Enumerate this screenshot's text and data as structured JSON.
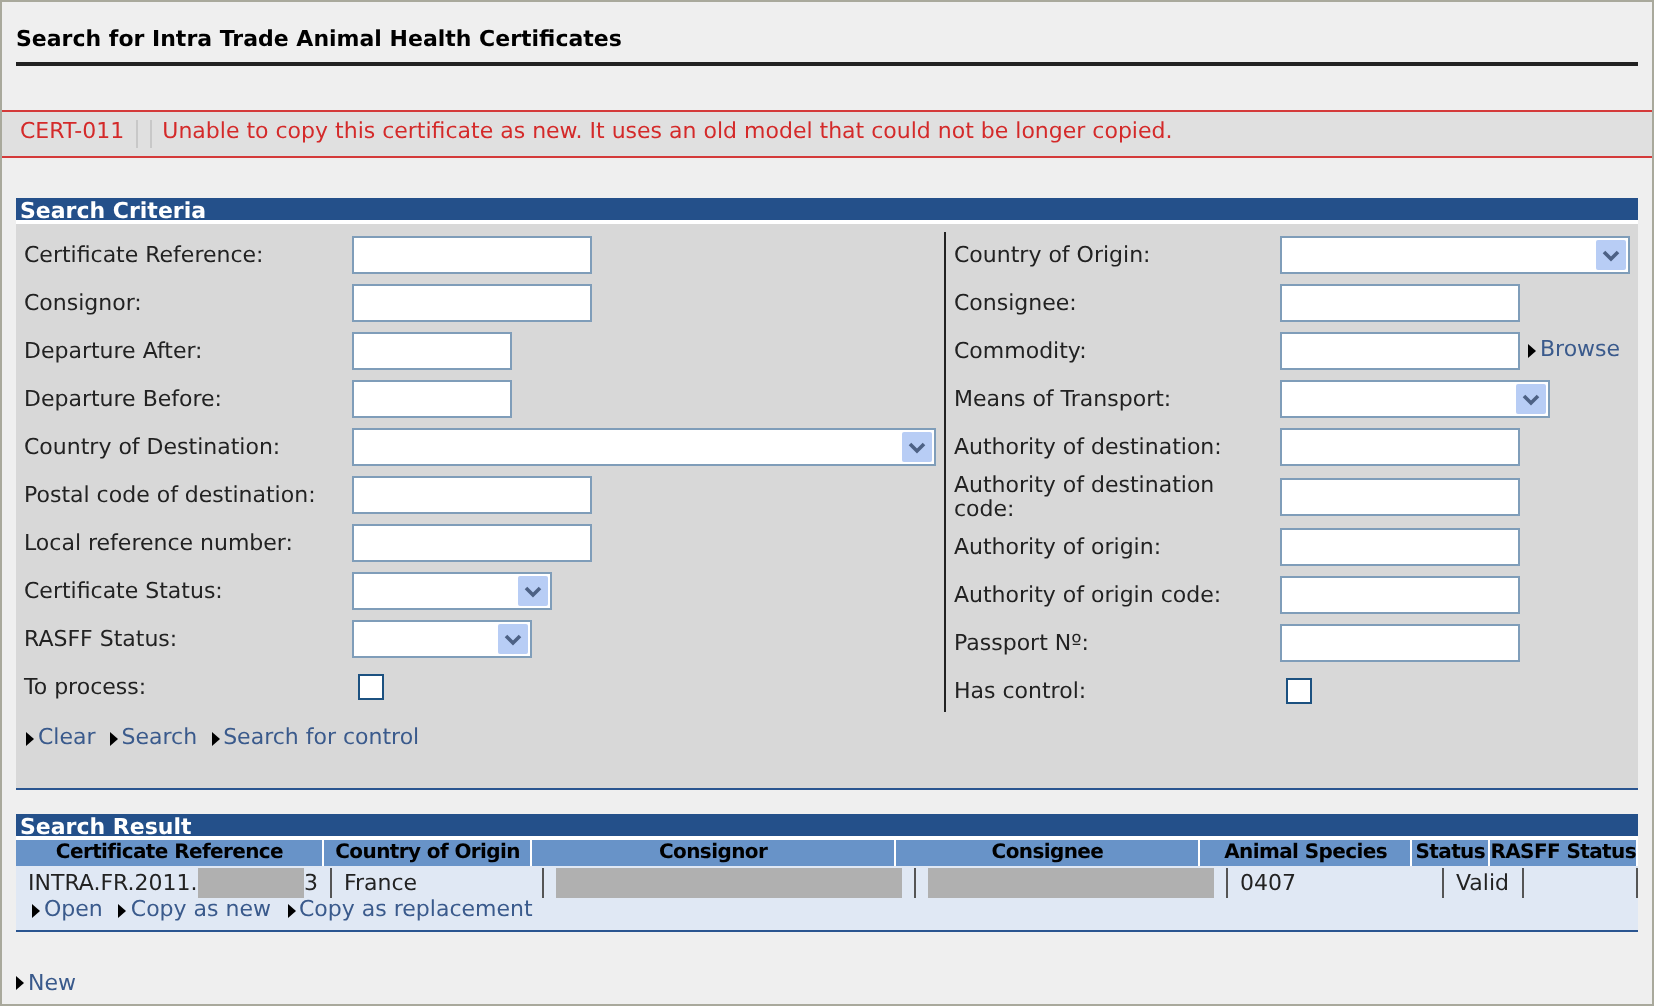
{
  "page_title": "Search for Intra Trade Animal Health Certificates",
  "error": {
    "code": "CERT-011",
    "message": "Unable to copy this certificate as new. It uses an old model that could not be longer copied."
  },
  "search_criteria": {
    "title": "Search Criteria",
    "left_fields": [
      {
        "label": "Certificate Reference:",
        "kind": "text"
      },
      {
        "label": "Consignor:",
        "kind": "text"
      },
      {
        "label": "Departure After:",
        "kind": "text"
      },
      {
        "label": "Departure Before:",
        "kind": "text"
      },
      {
        "label": "Country of Destination:",
        "kind": "select"
      },
      {
        "label": "Postal code of destination:",
        "kind": "text"
      },
      {
        "label": "Local reference number:",
        "kind": "text"
      },
      {
        "label": "Certificate Status:",
        "kind": "select"
      },
      {
        "label": "RASFF Status:",
        "kind": "select"
      },
      {
        "label": "To process:",
        "kind": "checkbox",
        "checked": false
      }
    ],
    "right_fields": [
      {
        "label": "Country of Origin:",
        "kind": "select"
      },
      {
        "label": "Consignee:",
        "kind": "text"
      },
      {
        "label": "Commodity:",
        "kind": "text",
        "link": "Browse"
      },
      {
        "label": "Means of Transport:",
        "kind": "select"
      },
      {
        "label": "Authority of destination:",
        "kind": "text"
      },
      {
        "label": "Authority of destination code:",
        "kind": "text"
      },
      {
        "label": "Authority of origin:",
        "kind": "text"
      },
      {
        "label": "Authority of origin code:",
        "kind": "text"
      },
      {
        "label": "Passport Nº:",
        "kind": "text"
      },
      {
        "label": "Has control:",
        "kind": "checkbox",
        "checked": false
      }
    ],
    "actions": [
      "Clear",
      "Search",
      "Search for control"
    ]
  },
  "search_result": {
    "title": "Search Result",
    "columns": [
      "Certificate Reference",
      "Country of Origin",
      "Consignor",
      "Consignee",
      "Animal Species",
      "Status",
      "RASFF Status"
    ],
    "rows": [
      {
        "cells": [
          {
            "text": "INTRA.FR.2011.",
            "redacted": true,
            "tail": "3"
          },
          {
            "text": "France",
            "redacted": false
          },
          {
            "redacted": true
          },
          {
            "redacted": true
          },
          {
            "text": "0407",
            "redacted": false
          },
          {
            "text": "Valid",
            "redacted": false
          },
          {
            "redacted": false
          }
        ],
        "actions": [
          "Open",
          "Copy as new",
          "Copy as replacement"
        ]
      }
    ]
  },
  "footer_actions": [
    "New"
  ]
}
